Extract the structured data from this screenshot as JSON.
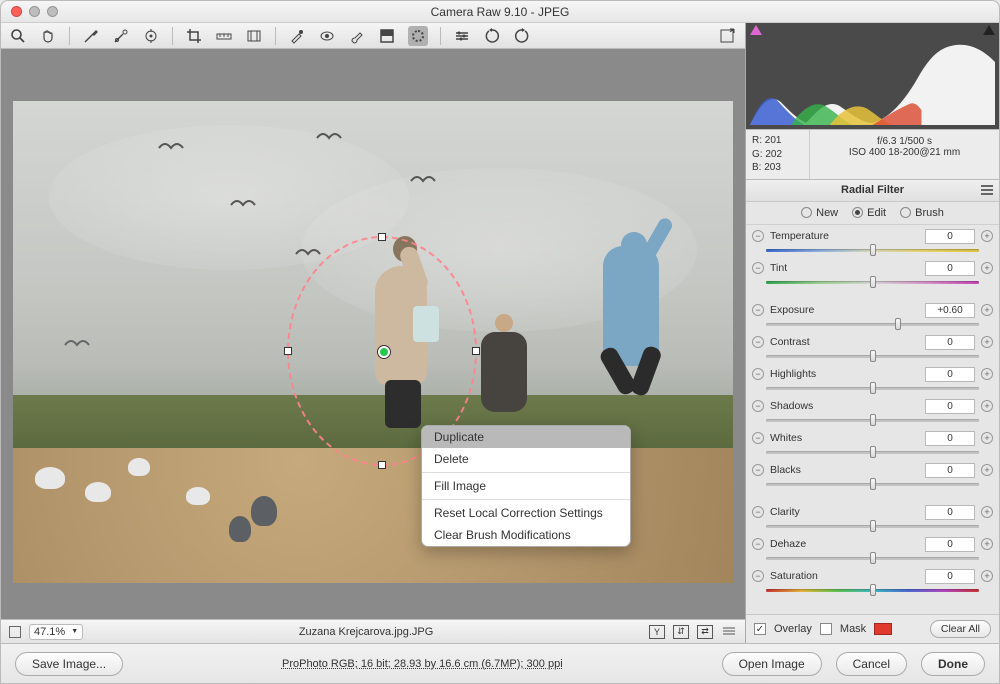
{
  "window": {
    "title": "Camera Raw 9.10  -  JPEG"
  },
  "statusbar": {
    "zoom": "47.1%",
    "filename": "Zuzana Krejcarova.jpg.JPG"
  },
  "footer": {
    "save": "Save Image...",
    "metadata": "ProPhoto RGB; 16 bit; 28.93 by 16.6 cm (6.7MP); 300 ppi",
    "open": "Open Image",
    "cancel": "Cancel",
    "done": "Done"
  },
  "context_menu": {
    "items": [
      "Duplicate",
      "Delete",
      "Fill Image",
      "Reset Local Correction Settings",
      "Clear Brush Modifications"
    ],
    "highlighted": 0
  },
  "rgb": {
    "r": "R:  201",
    "g": "G:  202",
    "b": "B:  203"
  },
  "exif": {
    "line1": "f/6.3    1/500 s",
    "line2": "ISO 400    18-200@21 mm"
  },
  "panel": {
    "title": "Radial Filter",
    "modes": {
      "new": "New",
      "edit": "Edit",
      "brush": "Brush",
      "selected": "edit"
    },
    "overlay": {
      "overlay_label": "Overlay",
      "overlay_checked": true,
      "mask_label": "Mask",
      "mask_checked": false,
      "clear": "Clear All"
    },
    "sliders": [
      {
        "name": "Temperature",
        "value": "0",
        "pos": 50,
        "bar": "bar-temp"
      },
      {
        "name": "Tint",
        "value": "0",
        "pos": 50,
        "bar": "bar-tint"
      },
      null,
      {
        "name": "Exposure",
        "value": "+0.60",
        "pos": 62,
        "bar": "bar-gray"
      },
      {
        "name": "Contrast",
        "value": "0",
        "pos": 50,
        "bar": "bar-gray"
      },
      {
        "name": "Highlights",
        "value": "0",
        "pos": 50,
        "bar": "bar-gray"
      },
      {
        "name": "Shadows",
        "value": "0",
        "pos": 50,
        "bar": "bar-gray"
      },
      {
        "name": "Whites",
        "value": "0",
        "pos": 50,
        "bar": "bar-gray"
      },
      {
        "name": "Blacks",
        "value": "0",
        "pos": 50,
        "bar": "bar-gray"
      },
      null,
      {
        "name": "Clarity",
        "value": "0",
        "pos": 50,
        "bar": "bar-gray"
      },
      {
        "name": "Dehaze",
        "value": "0",
        "pos": 50,
        "bar": "bar-gray"
      },
      {
        "name": "Saturation",
        "value": "0",
        "pos": 50,
        "bar": "bar-sat"
      }
    ]
  }
}
